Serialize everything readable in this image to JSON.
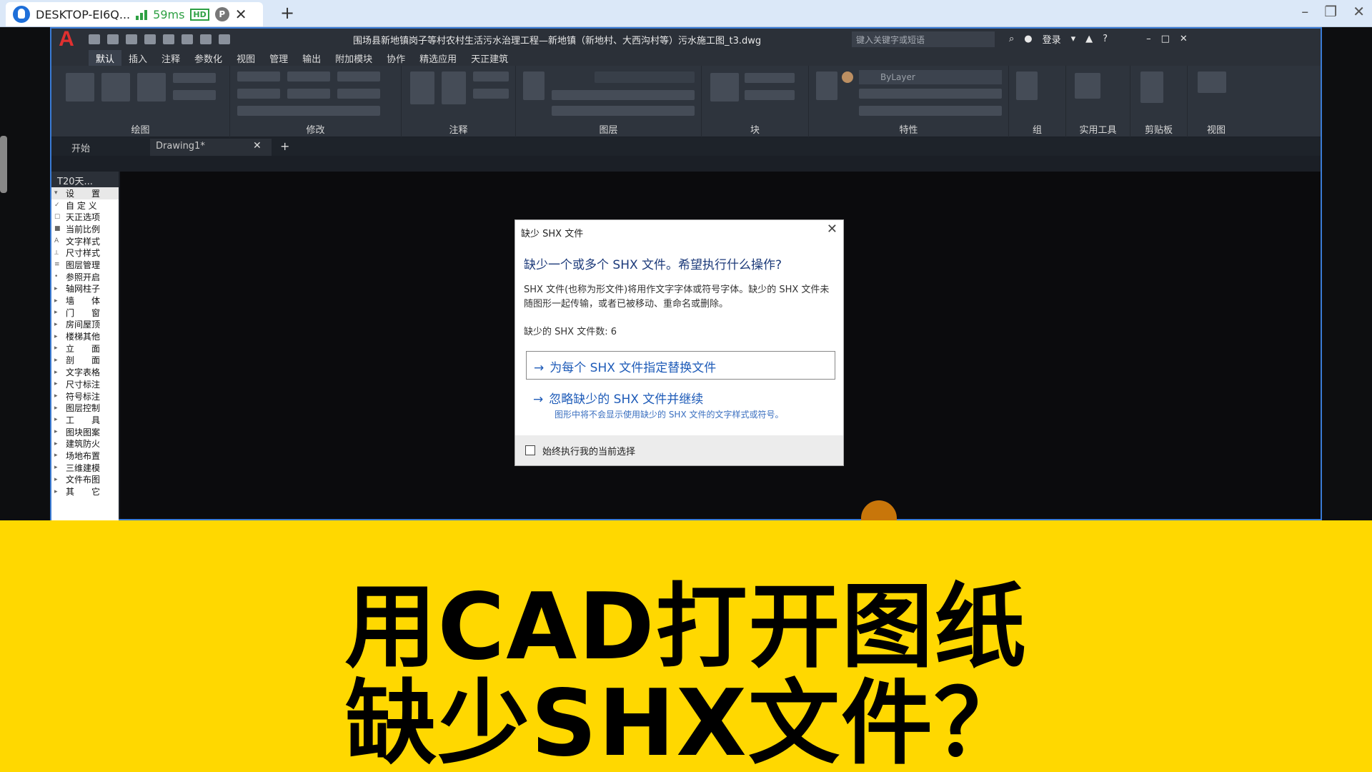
{
  "remote": {
    "tab_title": "DESKTOP-EI6Q...",
    "ping": "59ms",
    "hd": "HD",
    "p_badge": "P",
    "close": "✕",
    "add": "+"
  },
  "cad": {
    "doc_title": "围场县新地镇岗子等村农村生活污水治理工程—新地镇（新地村、大西沟村等）污水施工图_t3.dwg",
    "search_placeholder": "键入关键字或短语",
    "login": "登录",
    "menus": [
      "默认",
      "插入",
      "注释",
      "参数化",
      "视图",
      "管理",
      "输出",
      "附加模块",
      "协作",
      "精选应用",
      "天正建筑"
    ],
    "panels": [
      "绘图",
      "修改",
      "注释",
      "图层",
      "块",
      "特性",
      "组",
      "实用工具",
      "剪贴板",
      "视图"
    ],
    "bylayer": "ByLayer",
    "tabs": [
      "开始",
      "Drawing1*"
    ],
    "tab_add": "+",
    "tab_close": "✕"
  },
  "sidebar": {
    "header": "T20天...",
    "items": [
      {
        "label": "设　　置",
        "mark": "▾",
        "hl": true
      },
      {
        "label": "自 定 义",
        "mark": "✓"
      },
      {
        "label": "天正选项",
        "mark": "☐"
      },
      {
        "label": "当前比例",
        "mark": "■"
      },
      {
        "label": "文字样式",
        "mark": "A"
      },
      {
        "label": "尺寸样式",
        "mark": "⟂"
      },
      {
        "label": "图层管理",
        "mark": "≡"
      },
      {
        "label": "参照开启",
        "mark": "•"
      },
      {
        "label": "轴网柱子",
        "mark": "▸"
      },
      {
        "label": "墙　　体",
        "mark": "▸"
      },
      {
        "label": "门　　窗",
        "mark": "▸"
      },
      {
        "label": "房间屋顶",
        "mark": "▸"
      },
      {
        "label": "楼梯其他",
        "mark": "▸"
      },
      {
        "label": "立　　面",
        "mark": "▸"
      },
      {
        "label": "剖　　面",
        "mark": "▸"
      },
      {
        "label": "文字表格",
        "mark": "▸"
      },
      {
        "label": "尺寸标注",
        "mark": "▸"
      },
      {
        "label": "符号标注",
        "mark": "▸"
      },
      {
        "label": "图层控制",
        "mark": "▸"
      },
      {
        "label": "工　　具",
        "mark": "▸"
      },
      {
        "label": "图块图案",
        "mark": "▸"
      },
      {
        "label": "建筑防火",
        "mark": "▸"
      },
      {
        "label": "场地布置",
        "mark": "▸"
      },
      {
        "label": "三维建模",
        "mark": "▸"
      },
      {
        "label": "文件布图",
        "mark": "▸"
      },
      {
        "label": "其　　它",
        "mark": "▸"
      }
    ]
  },
  "dialog": {
    "title": "缺少 SHX 文件",
    "close": "✕",
    "question": "缺少一个或多个 SHX 文件。希望执行什么操作?",
    "desc": "SHX 文件(也称为形文件)将用作文字字体或符号字体。缺少的 SHX 文件未随图形一起传输，或者已被移动、重命名或删除。",
    "count": "缺少的 SHX 文件数: 6",
    "opt1": "为每个 SHX 文件指定替换文件",
    "opt2": "忽略缺少的 SHX 文件并继续",
    "opt2_sub": "图形中将不会显示使用缺少的 SHX 文件的文字样式或符号。",
    "arrow": "→",
    "always": "始终执行我的当前选择"
  },
  "banner": {
    "line1": "用CAD打开图纸",
    "line2": "缺少SHX文件？"
  }
}
